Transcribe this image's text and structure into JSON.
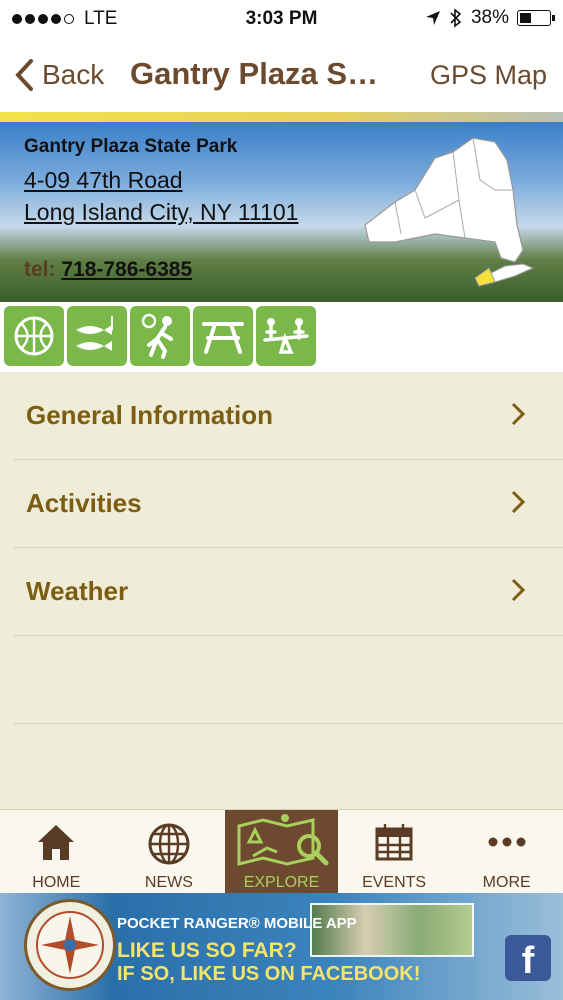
{
  "status": {
    "carrier": "LTE",
    "time": "3:03 PM",
    "battery": "38%",
    "battery_level": 0.38
  },
  "nav": {
    "back_label": "Back",
    "title": "Gantry Plaza S…",
    "right_label": "GPS Map"
  },
  "park": {
    "name": "Gantry Plaza State Park",
    "address_line1": "4-09 47th Road",
    "address_line2": "Long Island City, NY 11101",
    "tel_label": "tel:",
    "tel": "718-786-6385"
  },
  "activity_icons": [
    "basketball-icon",
    "fishing-icon",
    "playground-icon",
    "picnic-table-icon",
    "seesaw-icon"
  ],
  "menu": {
    "items": [
      {
        "label": "General Information"
      },
      {
        "label": "Activities"
      },
      {
        "label": "Weather"
      }
    ]
  },
  "tabs": [
    {
      "label": "HOME",
      "icon": "home-icon"
    },
    {
      "label": "NEWS",
      "icon": "globe-icon"
    },
    {
      "label": "EXPLORE",
      "icon": "explore-map-icon",
      "active": true
    },
    {
      "label": "EVENTS",
      "icon": "calendar-icon"
    },
    {
      "label": "MORE",
      "icon": "more-icon"
    }
  ],
  "ad": {
    "line1": "POCKET RANGER® MOBILE APP",
    "line2": "LIKE US SO FAR?",
    "line3": "IF SO, LIKE US ON FACEBOOK!",
    "logo_text": "POCKET RANGER"
  },
  "colors": {
    "accent_brown": "#6b4a2e",
    "menu_text": "#7c5d12",
    "activity_green": "#7ab84a",
    "tab_active_bg": "#6d4a2f",
    "tab_active_text": "#a9cf5c"
  }
}
